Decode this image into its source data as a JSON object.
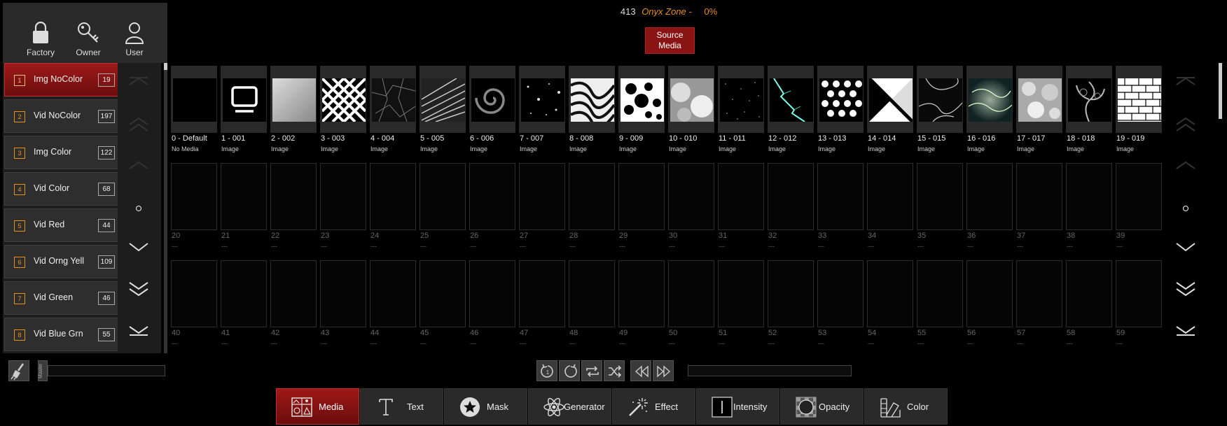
{
  "header": {
    "id": "413",
    "zone_name": "Onyx Zone -",
    "percent": "0%",
    "source_button": "Source Media"
  },
  "user_panel": [
    {
      "label": "Factory",
      "icon": "lock-icon"
    },
    {
      "label": "Owner",
      "icon": "key-icon"
    },
    {
      "label": "User",
      "icon": "user-icon"
    }
  ],
  "categories": [
    {
      "num": "1",
      "label": "Img NoColor",
      "count": "19",
      "selected": true
    },
    {
      "num": "2",
      "label": "Vid NoColor",
      "count": "197"
    },
    {
      "num": "3",
      "label": "Img Color",
      "count": "122"
    },
    {
      "num": "4",
      "label": "Vid Color",
      "count": "68"
    },
    {
      "num": "5",
      "label": "Vid Red",
      "count": "44"
    },
    {
      "num": "6",
      "label": "Vid Orng Yell",
      "count": "109"
    },
    {
      "num": "7",
      "label": "Vid Green",
      "count": "46"
    },
    {
      "num": "8",
      "label": "Vid Blue Grn",
      "count": "55"
    }
  ],
  "media": [
    {
      "title": "0 - Default",
      "sub": "No Media",
      "art": "none"
    },
    {
      "title": "1 - 001",
      "sub": "Image",
      "art": "monitor"
    },
    {
      "title": "2 - 002",
      "sub": "Image",
      "art": "gray"
    },
    {
      "title": "3 - 003",
      "sub": "Image",
      "art": "diamonds"
    },
    {
      "title": "4 - 004",
      "sub": "Image",
      "art": "cracks"
    },
    {
      "title": "5 - 005",
      "sub": "Image",
      "art": "streaks"
    },
    {
      "title": "6 - 006",
      "sub": "Image",
      "art": "spiral"
    },
    {
      "title": "7 - 007",
      "sub": "Image",
      "art": "specks"
    },
    {
      "title": "8 - 008",
      "sub": "Image",
      "art": "zebra"
    },
    {
      "title": "9 - 009",
      "sub": "Image",
      "art": "holes"
    },
    {
      "title": "10 - 010",
      "sub": "Image",
      "art": "clouds"
    },
    {
      "title": "11 - 011",
      "sub": "Image",
      "art": "stars"
    },
    {
      "title": "12 - 012",
      "sub": "Image",
      "art": "lightning"
    },
    {
      "title": "13 - 013",
      "sub": "Image",
      "art": "dots"
    },
    {
      "title": "14 - 014",
      "sub": "Image",
      "art": "diagonal"
    },
    {
      "title": "15 - 015",
      "sub": "Image",
      "art": "marble"
    },
    {
      "title": "16 - 016",
      "sub": "Image",
      "art": "water"
    },
    {
      "title": "17 - 017",
      "sub": "Image",
      "art": "bokeh"
    },
    {
      "title": "18 - 018",
      "sub": "Image",
      "art": "smoke"
    },
    {
      "title": "19 - 019",
      "sub": "Image",
      "art": "bricks"
    },
    {
      "title": "20",
      "sub": "---"
    },
    {
      "title": "21",
      "sub": "---"
    },
    {
      "title": "22",
      "sub": "---"
    },
    {
      "title": "23",
      "sub": "---"
    },
    {
      "title": "24",
      "sub": "---"
    },
    {
      "title": "25",
      "sub": "---"
    },
    {
      "title": "26",
      "sub": "---"
    },
    {
      "title": "27",
      "sub": "---"
    },
    {
      "title": "28",
      "sub": "---"
    },
    {
      "title": "29",
      "sub": "---"
    },
    {
      "title": "30",
      "sub": "---"
    },
    {
      "title": "31",
      "sub": "---"
    },
    {
      "title": "32",
      "sub": "---"
    },
    {
      "title": "33",
      "sub": "---"
    },
    {
      "title": "34",
      "sub": "---"
    },
    {
      "title": "35",
      "sub": "---"
    },
    {
      "title": "36",
      "sub": "---"
    },
    {
      "title": "37",
      "sub": "---"
    },
    {
      "title": "38",
      "sub": "---"
    },
    {
      "title": "39",
      "sub": "---"
    },
    {
      "title": "40",
      "sub": "---"
    },
    {
      "title": "41",
      "sub": "---"
    },
    {
      "title": "42",
      "sub": "---"
    },
    {
      "title": "43",
      "sub": "---"
    },
    {
      "title": "44",
      "sub": "---"
    },
    {
      "title": "45",
      "sub": "---"
    },
    {
      "title": "46",
      "sub": "---"
    },
    {
      "title": "47",
      "sub": "---"
    },
    {
      "title": "48",
      "sub": "---"
    },
    {
      "title": "49",
      "sub": "---"
    },
    {
      "title": "50",
      "sub": "---"
    },
    {
      "title": "51",
      "sub": "---"
    },
    {
      "title": "52",
      "sub": "---"
    },
    {
      "title": "53",
      "sub": "---"
    },
    {
      "title": "54",
      "sub": "---"
    },
    {
      "title": "55",
      "sub": "---"
    },
    {
      "title": "56",
      "sub": "---"
    },
    {
      "title": "57",
      "sub": "---"
    },
    {
      "title": "58",
      "sub": "---"
    },
    {
      "title": "59",
      "sub": "---"
    }
  ],
  "footer": {
    "master_label": "Master"
  },
  "tabs": [
    {
      "label": "Media",
      "icon": "media-icon",
      "active": true
    },
    {
      "label": "Text",
      "icon": "text-icon"
    },
    {
      "label": "Mask",
      "icon": "star-icon"
    },
    {
      "label": "Generator",
      "icon": "atom-icon"
    },
    {
      "label": "Effect",
      "icon": "magic-wand-icon"
    },
    {
      "label": "Intensity",
      "icon": "intensity-icon"
    },
    {
      "label": "Opacity",
      "icon": "opacity-icon"
    },
    {
      "label": "Color",
      "icon": "color-swatch-icon"
    }
  ],
  "colors": {
    "accent_red": "#9e1a1a",
    "accent_orange": "#e8901a"
  }
}
